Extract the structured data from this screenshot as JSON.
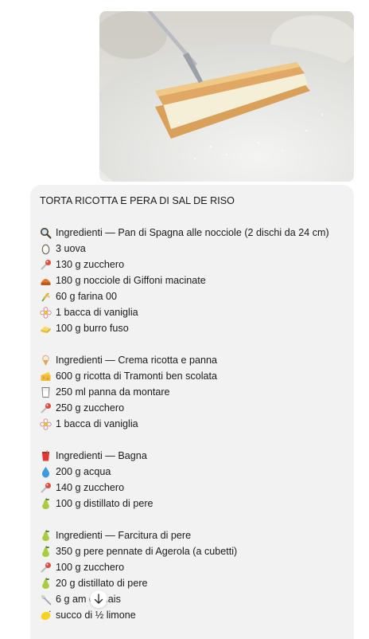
{
  "image": {
    "alt": "Torta ricotta e pera"
  },
  "message": {
    "title": "TORTA RICOTTA E PERA DI SAL DE RISO",
    "sections": [
      {
        "header": {
          "icon": "magnifier-icon",
          "text": "Ingredienti — Pan di Spagna alle nocciole (2 dischi da 24 cm)"
        },
        "items": [
          {
            "icon": "egg-icon",
            "text": "3 uova"
          },
          {
            "icon": "candy-icon",
            "text": "130 g zucchero"
          },
          {
            "icon": "chestnut-icon",
            "text": "180 g nocciole di Giffoni macinate"
          },
          {
            "icon": "wheat-icon",
            "text": "60 g farina 00"
          },
          {
            "icon": "flower-icon",
            "text": "1 bacca di vaniglia"
          },
          {
            "icon": "butter-icon",
            "text": "100 g burro fuso"
          }
        ]
      },
      {
        "header": {
          "icon": "ice-cream-icon",
          "text": "Ingredienti — Crema ricotta e panna"
        },
        "items": [
          {
            "icon": "cheese-icon",
            "text": "600 g ricotta di Tramonti ben scolata"
          },
          {
            "icon": "glass-icon",
            "text": "250 ml panna da montare"
          },
          {
            "icon": "candy-icon",
            "text": "250 g zucchero"
          },
          {
            "icon": "flower-icon",
            "text": "1 bacca di vaniglia"
          }
        ]
      },
      {
        "header": {
          "icon": "cup-icon",
          "text": "Ingredienti — Bagna"
        },
        "items": [
          {
            "icon": "droplet-icon",
            "text": "200 g acqua"
          },
          {
            "icon": "candy-icon",
            "text": "140 g zucchero"
          },
          {
            "icon": "pear-icon",
            "text": "100 g distillato di pere"
          }
        ]
      },
      {
        "header": {
          "icon": "pear-icon",
          "text": "Ingredienti — Farcitura di pere"
        },
        "items": [
          {
            "icon": "pear-icon",
            "text": "350 g pere pennate di Agerola (a cubetti)"
          },
          {
            "icon": "candy-icon",
            "text": "100 g zucchero"
          },
          {
            "icon": "pear-icon",
            "text": "20 g distillato di pere"
          },
          {
            "icon": "spoon-icon",
            "text": "6 g am   di mais"
          },
          {
            "icon": "lemon-icon",
            "text": "succo di ½ limone"
          }
        ]
      }
    ]
  },
  "scroll_button": {
    "icon": "arrow-down-icon"
  }
}
